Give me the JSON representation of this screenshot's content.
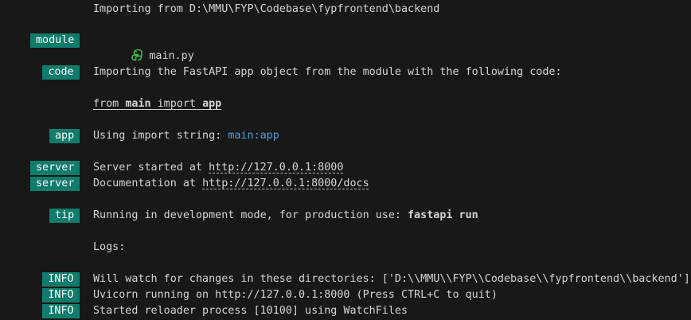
{
  "lines": {
    "importing": "Importing from D:\\MMU\\FYP\\Codebase\\fypfrontend\\backend",
    "module": {
      "tag": "module",
      "icon": "python-icon",
      "file": "main.py"
    },
    "code": {
      "tag": "code",
      "text": "Importing the FastAPI app object from the module with the following code:"
    },
    "code_snippet": {
      "from": "from",
      "module": "main",
      "import": "import",
      "app": "app"
    },
    "app": {
      "tag": "app",
      "prefix": "Using import string: ",
      "value": "main:app"
    },
    "server1": {
      "tag": "server",
      "prefix": "Server started at ",
      "url": "http://127.0.0.1:8000"
    },
    "server2": {
      "tag": "server",
      "prefix": "Documentation at ",
      "url": "http://127.0.0.1:8000/docs"
    },
    "tip": {
      "tag": "tip",
      "prefix": "Running in development mode, for production use: ",
      "cmd": "fastapi run"
    },
    "logs": "Logs:",
    "info1": {
      "tag": "INFO",
      "text": "Will watch for changes in these directories: ['D:\\\\MMU\\\\FYP\\\\Codebase\\\\fypfrontend\\\\backend']"
    },
    "info2": {
      "tag": "INFO",
      "text": "Uvicorn running on http://127.0.0.1:8000 (Press CTRL+C to quit)"
    },
    "info3": {
      "tag": "INFO",
      "text": "Started reloader process [10100] using WatchFiles"
    }
  },
  "colors": {
    "background": "#181818",
    "tag_bg": "#107c6c",
    "text": "#d4d4d4",
    "accent_blue": "#569cd6",
    "icon_green": "#3fb950"
  }
}
